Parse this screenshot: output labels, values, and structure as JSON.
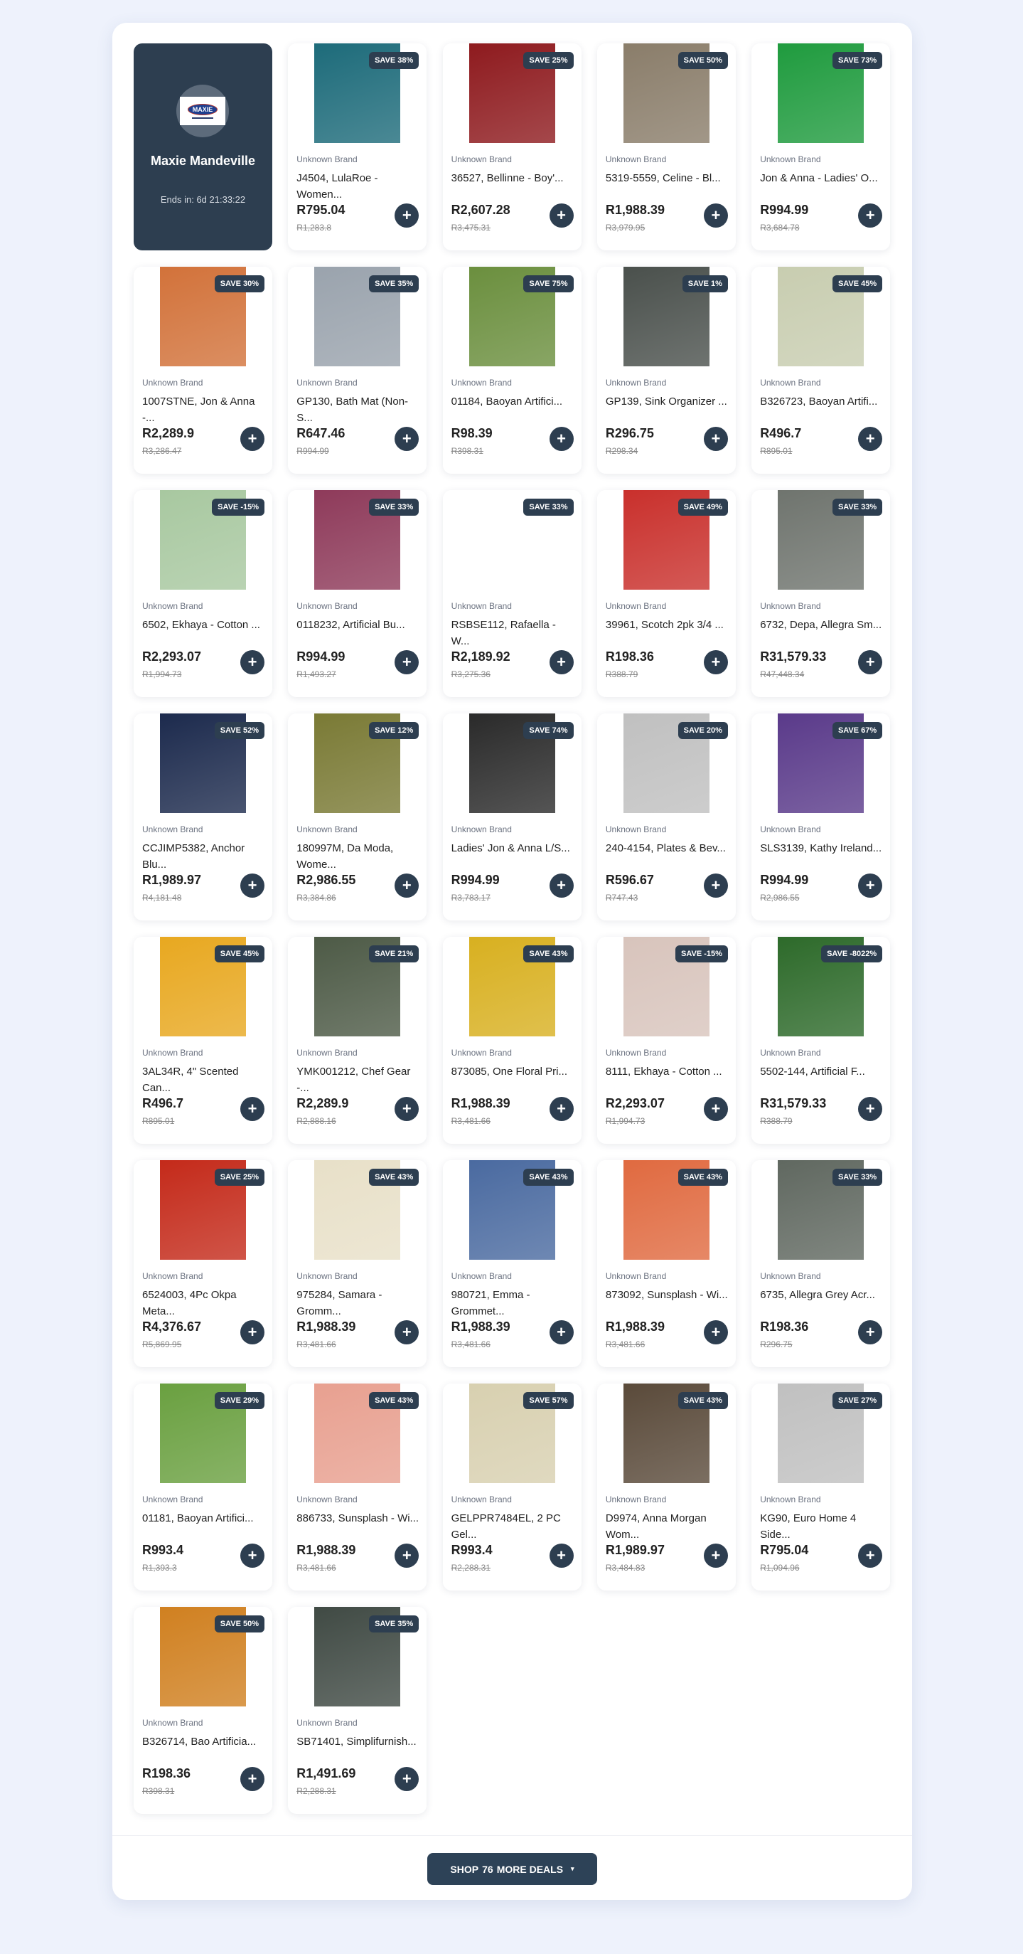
{
  "seller": {
    "name": "Maxie Mandeville",
    "ends_in": "Ends in: 6d 21:33:22",
    "logo_text": "MAXIE"
  },
  "accent_color": "#2d3e50",
  "products": [
    {
      "badge": "SAVE 38%",
      "brand": "Unknown Brand",
      "name": "J4504, LulaRoe - Women...",
      "price": "R795.04",
      "old_price": "R1,283.8"
    },
    {
      "badge": "SAVE 25%",
      "brand": "Unknown Brand",
      "name": "36527, Bellinne - Boy'...",
      "price": "R2,607.28",
      "old_price": "R3,475.31"
    },
    {
      "badge": "SAVE 50%",
      "brand": "Unknown Brand",
      "name": "5319-5559, Celine - Bl...",
      "price": "R1,988.39",
      "old_price": "R3,979.95"
    },
    {
      "badge": "SAVE 73%",
      "brand": "Unknown Brand",
      "name": "Jon & Anna - Ladies' O...",
      "price": "R994.99",
      "old_price": "R3,684.78"
    },
    {
      "badge": "SAVE 30%",
      "brand": "Unknown Brand",
      "name": "1007STNE, Jon & Anna -...",
      "price": "R2,289.9",
      "old_price": "R3,286.47"
    },
    {
      "badge": "SAVE 35%",
      "brand": "Unknown Brand",
      "name": "GP130, Bath Mat (Non-S...",
      "price": "R647.46",
      "old_price": "R994.99"
    },
    {
      "badge": "SAVE 75%",
      "brand": "Unknown Brand",
      "name": "01184, Baoyan Artifici...",
      "price": "R98.39",
      "old_price": "R398.31"
    },
    {
      "badge": "SAVE 1%",
      "brand": "Unknown Brand",
      "name": "GP139, Sink Organizer ...",
      "price": "R296.75",
      "old_price": "R298.34"
    },
    {
      "badge": "SAVE 45%",
      "brand": "Unknown Brand",
      "name": "B326723, Baoyan Artifi...",
      "price": "R496.7",
      "old_price": "R895.01"
    },
    {
      "badge": "SAVE -15%",
      "brand": "Unknown Brand",
      "name": "6502, Ekhaya - Cotton ...",
      "price": "R2,293.07",
      "old_price": "R1,994.73"
    },
    {
      "badge": "SAVE 33%",
      "brand": "Unknown Brand",
      "name": "0118232, Artificial Bu...",
      "price": "R994.99",
      "old_price": "R1,493.27"
    },
    {
      "badge": "SAVE 33%",
      "brand": "Unknown Brand",
      "name": "RSBSE112, Rafaella - W...",
      "price": "R2,189.92",
      "old_price": "R3,275.36"
    },
    {
      "badge": "SAVE 49%",
      "brand": "Unknown Brand",
      "name": "39961, Scotch 2pk 3/4 ...",
      "price": "R198.36",
      "old_price": "R388.79"
    },
    {
      "badge": "SAVE 33%",
      "brand": "Unknown Brand",
      "name": "6732, Depa, Allegra Sm...",
      "price": "R31,579.33",
      "old_price": "R47,448.34"
    },
    {
      "badge": "SAVE 52%",
      "brand": "Unknown Brand",
      "name": "CCJIMP5382, Anchor Blu...",
      "price": "R1,989.97",
      "old_price": "R4,181.48"
    },
    {
      "badge": "SAVE 12%",
      "brand": "Unknown Brand",
      "name": "180997M, Da Moda, Wome...",
      "price": "R2,986.55",
      "old_price": "R3,384.86"
    },
    {
      "badge": "SAVE 74%",
      "brand": "Unknown Brand",
      "name": "Ladies' Jon & Anna L/S...",
      "price": "R994.99",
      "old_price": "R3,783.17"
    },
    {
      "badge": "SAVE 20%",
      "brand": "Unknown Brand",
      "name": "240-4154, Plates & Bev...",
      "price": "R596.67",
      "old_price": "R747.43"
    },
    {
      "badge": "SAVE 67%",
      "brand": "Unknown Brand",
      "name": "SLS3139, Kathy Ireland...",
      "price": "R994.99",
      "old_price": "R2,986.55"
    },
    {
      "badge": "SAVE 45%",
      "brand": "Unknown Brand",
      "name": "3AL34R, 4\" Scented Can...",
      "price": "R496.7",
      "old_price": "R895.01"
    },
    {
      "badge": "SAVE 21%",
      "brand": "Unknown Brand",
      "name": "YMK001212, Chef Gear -...",
      "price": "R2,289.9",
      "old_price": "R2,888.16"
    },
    {
      "badge": "SAVE 43%",
      "brand": "Unknown Brand",
      "name": "873085, One Floral Pri...",
      "price": "R1,988.39",
      "old_price": "R3,481.66"
    },
    {
      "badge": "SAVE -15%",
      "brand": "Unknown Brand",
      "name": "8111, Ekhaya - Cotton ...",
      "price": "R2,293.07",
      "old_price": "R1,994.73"
    },
    {
      "badge": "SAVE -8022%",
      "brand": "Unknown Brand",
      "name": "5502-144, Artificial F...",
      "price": "R31,579.33",
      "old_price": "R388.79"
    },
    {
      "badge": "SAVE 25%",
      "brand": "Unknown Brand",
      "name": "6524003, 4Pc Okpa Meta...",
      "price": "R4,376.67",
      "old_price": "R5,869.95"
    },
    {
      "badge": "SAVE 43%",
      "brand": "Unknown Brand",
      "name": "975284, Samara - Gromm...",
      "price": "R1,988.39",
      "old_price": "R3,481.66"
    },
    {
      "badge": "SAVE 43%",
      "brand": "Unknown Brand",
      "name": "980721, Emma - Grommet...",
      "price": "R1,988.39",
      "old_price": "R3,481.66"
    },
    {
      "badge": "SAVE 43%",
      "brand": "Unknown Brand",
      "name": "873092, Sunsplash - Wi...",
      "price": "R1,988.39",
      "old_price": "R3,481.66"
    },
    {
      "badge": "SAVE 33%",
      "brand": "Unknown Brand",
      "name": "6735, Allegra Grey Acr...",
      "price": "R198.36",
      "old_price": "R296.75"
    },
    {
      "badge": "SAVE 29%",
      "brand": "Unknown Brand",
      "name": "01181, Baoyan Artifici...",
      "price": "R993.4",
      "old_price": "R1,393.3"
    },
    {
      "badge": "SAVE 43%",
      "brand": "Unknown Brand",
      "name": "886733, Sunsplash - Wi...",
      "price": "R1,988.39",
      "old_price": "R3,481.66"
    },
    {
      "badge": "SAVE 57%",
      "brand": "Unknown Brand",
      "name": "GELPPR7484EL, 2 PC Gel...",
      "price": "R993.4",
      "old_price": "R2,288.31"
    },
    {
      "badge": "SAVE 43%",
      "brand": "Unknown Brand",
      "name": "D9974, Anna Morgan Wom...",
      "price": "R1,989.97",
      "old_price": "R3,484.83"
    },
    {
      "badge": "SAVE 27%",
      "brand": "Unknown Brand",
      "name": "KG90, Euro Home 4 Side...",
      "price": "R795.04",
      "old_price": "R1,094.96"
    },
    {
      "badge": "SAVE 50%",
      "brand": "Unknown Brand",
      "name": "B326714, Bao Artificia...",
      "price": "R198.36",
      "old_price": "R398.31"
    },
    {
      "badge": "SAVE 35%",
      "brand": "Unknown Brand",
      "name": "SB71401, Simplifurnish...",
      "price": "R1,491.69",
      "old_price": "R2,288.31"
    }
  ],
  "add_label": "+",
  "footer": {
    "shop_prefix": "SHOP",
    "more_count": "76",
    "shop_suffix": "MORE DEALS",
    "caret": "▾"
  }
}
